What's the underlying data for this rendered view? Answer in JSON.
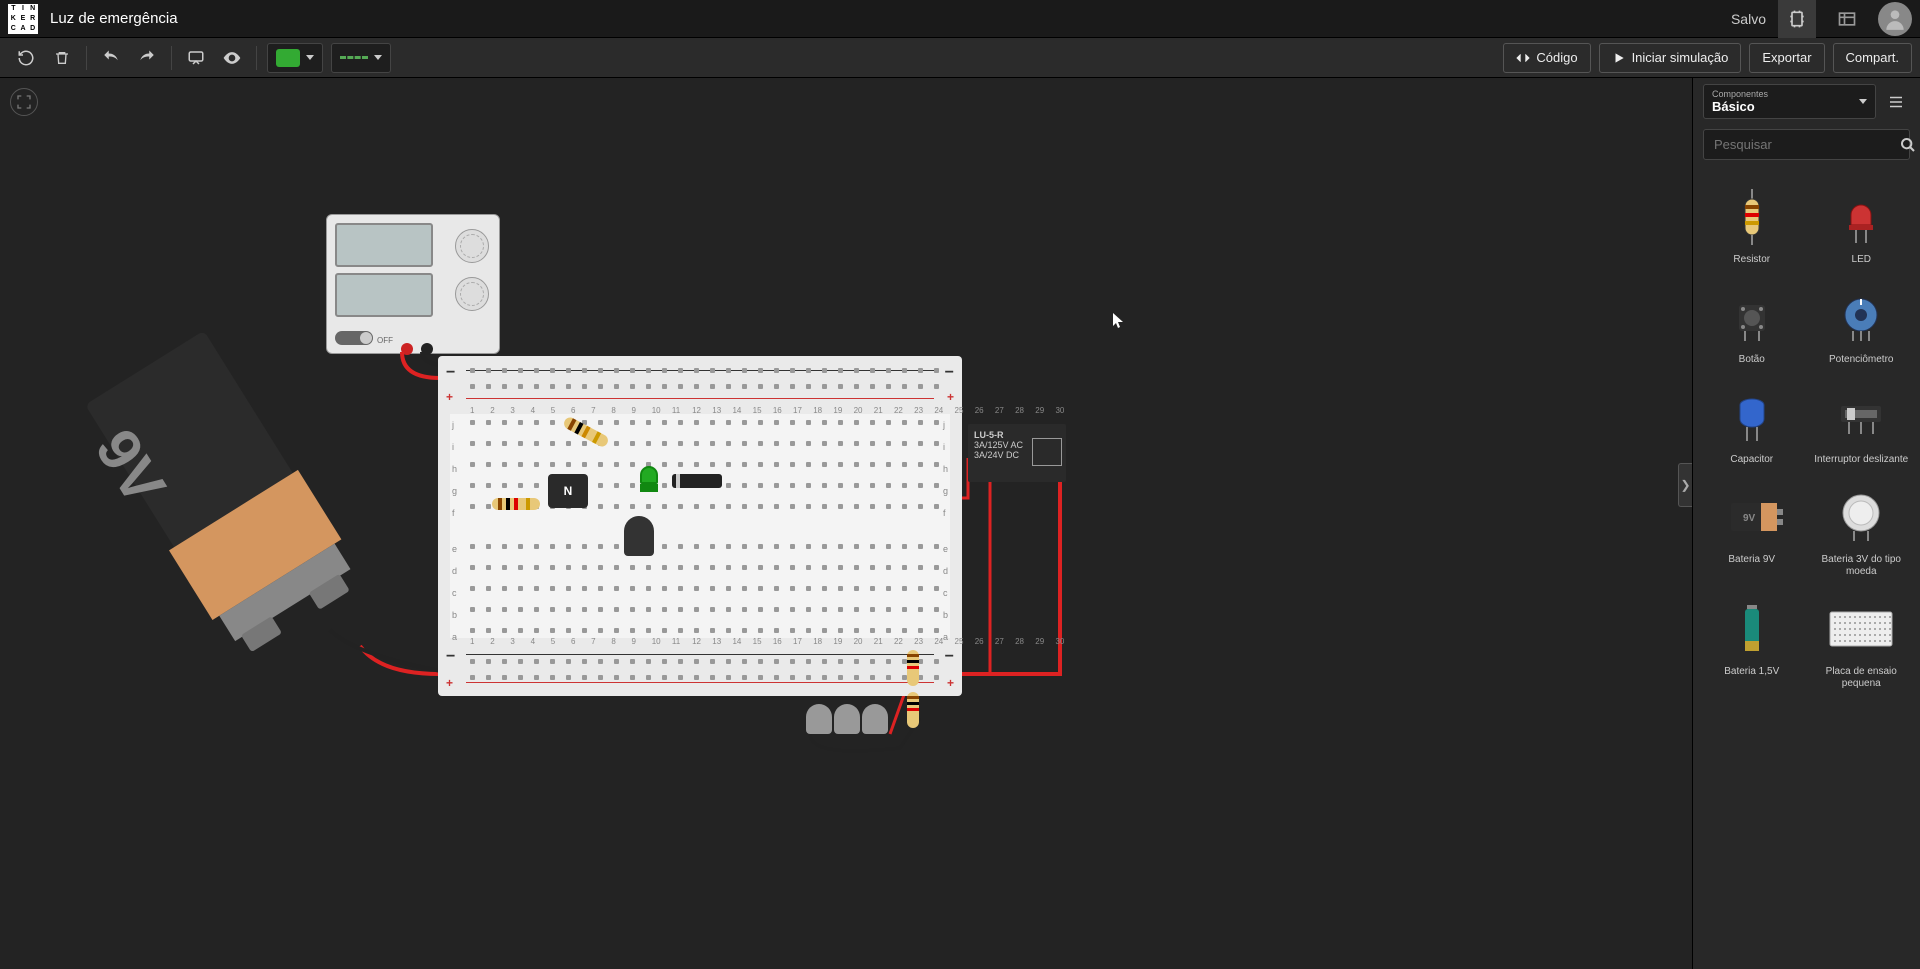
{
  "titlebar": {
    "logo_letters": [
      "T",
      "I",
      "N",
      "K",
      "E",
      "R",
      "C",
      "A",
      "D"
    ],
    "project_name": "Luz de emergência",
    "save_status": "Salvo"
  },
  "toolbar": {
    "component_color": "#3a3",
    "wire_color": "#3a3",
    "code_label": "Código",
    "simulate_label": "Iniciar simulação",
    "export_label": "Exportar",
    "share_label": "Compart."
  },
  "panel": {
    "category_small": "Componentes",
    "category": "Básico",
    "search_placeholder": "Pesquisar",
    "components": [
      {
        "name": "Resistor",
        "key": "resistor"
      },
      {
        "name": "LED",
        "key": "led"
      },
      {
        "name": "Botão",
        "key": "button"
      },
      {
        "name": "Potenciômetro",
        "key": "pot"
      },
      {
        "name": "Capacitor",
        "key": "capacitor"
      },
      {
        "name": "Interruptor deslizante",
        "key": "slideswitch"
      },
      {
        "name": "Bateria 9V",
        "key": "bat9v"
      },
      {
        "name": "Bateria 3V do tipo moeda",
        "key": "coincell"
      },
      {
        "name": "Bateria 1,5V",
        "key": "bat15v"
      },
      {
        "name": "Placa de ensaio pequena",
        "key": "breadboard"
      }
    ]
  },
  "scene": {
    "psu_off_label": "OFF",
    "battery_label": "9V",
    "relay": {
      "model": "LU-5-R",
      "line1": "3A/125V AC",
      "line2": "3A/24V  DC"
    },
    "transistor_label": "N",
    "breadboard_cols": "30",
    "breadboard_rows_top": [
      "j",
      "i",
      "h",
      "g",
      "f"
    ],
    "breadboard_rows_bot": [
      "e",
      "d",
      "c",
      "b",
      "a"
    ]
  }
}
